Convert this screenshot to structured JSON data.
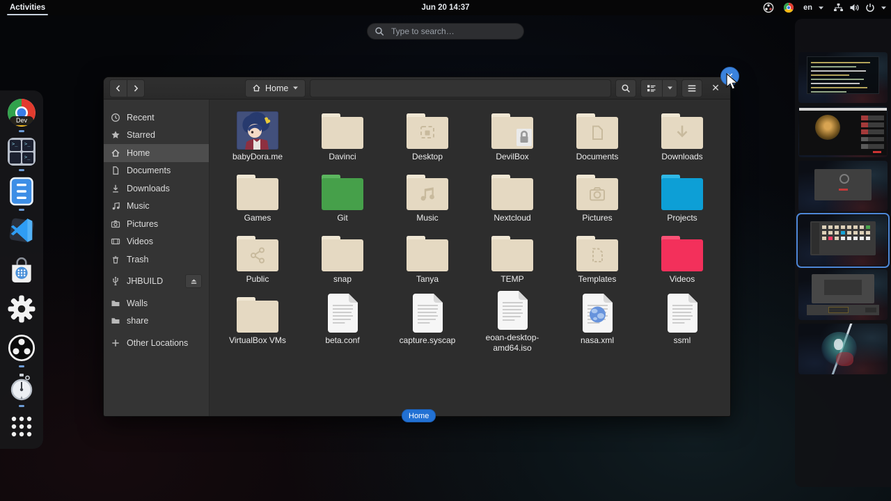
{
  "topbar": {
    "activities_label": "Activities",
    "clock": "Jun 20 14:37",
    "language": "en",
    "tray_icons": [
      "obs-icon",
      "chrome-icon",
      "language-menu",
      "network-icon",
      "volume-icon",
      "power-icon",
      "caret-down-icon"
    ]
  },
  "overview_search": {
    "placeholder": "Type to search…"
  },
  "dock": {
    "items": [
      {
        "id": "chrome-dev",
        "icon": "chrome-dev",
        "badge": "Dev",
        "running": true
      },
      {
        "id": "terminator",
        "icon": "terminator",
        "running": true
      },
      {
        "id": "files",
        "icon": "files",
        "running": true
      },
      {
        "id": "vscode",
        "icon": "vscode",
        "running": false
      },
      {
        "id": "software",
        "icon": "software",
        "running": false
      },
      {
        "id": "settings",
        "icon": "settings",
        "running": false
      },
      {
        "id": "obs",
        "icon": "obs",
        "running": true
      },
      {
        "id": "clocks",
        "icon": "stopwatch",
        "running": true
      },
      {
        "id": "app-grid",
        "icon": "app-grid",
        "running": false
      }
    ]
  },
  "window": {
    "toolbar": {
      "breadcrumb_label": "Home"
    },
    "sidebar": {
      "items": [
        {
          "icon": "clock",
          "label": "Recent"
        },
        {
          "icon": "star",
          "label": "Starred"
        },
        {
          "icon": "home",
          "label": "Home",
          "selected": true
        },
        {
          "icon": "document",
          "label": "Documents"
        },
        {
          "icon": "download",
          "label": "Downloads"
        },
        {
          "icon": "music",
          "label": "Music"
        },
        {
          "icon": "camera",
          "label": "Pictures"
        },
        {
          "icon": "film",
          "label": "Videos"
        },
        {
          "icon": "trash",
          "label": "Trash"
        },
        {
          "icon": "usb",
          "label": "JHBUILD",
          "eject": true,
          "gap": true
        },
        {
          "icon": "folder",
          "label": "Walls",
          "gap": true
        },
        {
          "icon": "folder",
          "label": "share"
        },
        {
          "icon": "plus",
          "label": "Other Locations",
          "gap": true
        }
      ]
    },
    "folder_colors": {
      "cream": "#e5d9c2",
      "green": "#46a04a",
      "cyan": "#0d9fd6",
      "pink": "#f3305b"
    },
    "files": [
      {
        "name": "babyDora.me",
        "icon": "image"
      },
      {
        "name": "Davinci",
        "icon": "folder",
        "color": "cream"
      },
      {
        "name": "Desktop",
        "icon": "folder",
        "color": "cream",
        "emblem": "desktop"
      },
      {
        "name": "DevilBox",
        "icon": "folder",
        "color": "cream",
        "emblem": "lock"
      },
      {
        "name": "Documents",
        "icon": "folder",
        "color": "cream",
        "emblem": "document"
      },
      {
        "name": "Downloads",
        "icon": "folder",
        "color": "cream",
        "emblem": "download"
      },
      {
        "name": "Games",
        "icon": "folder",
        "color": "cream"
      },
      {
        "name": "Git",
        "icon": "folder",
        "color": "green"
      },
      {
        "name": "Music",
        "icon": "folder",
        "color": "cream",
        "emblem": "music"
      },
      {
        "name": "Nextcloud",
        "icon": "folder",
        "color": "cream"
      },
      {
        "name": "Pictures",
        "icon": "folder",
        "color": "cream",
        "emblem": "camera"
      },
      {
        "name": "Projects",
        "icon": "folder",
        "color": "cyan"
      },
      {
        "name": "Public",
        "icon": "folder",
        "color": "cream",
        "emblem": "share"
      },
      {
        "name": "snap",
        "icon": "folder",
        "color": "cream"
      },
      {
        "name": "Tanya",
        "icon": "folder",
        "color": "cream"
      },
      {
        "name": "TEMP",
        "icon": "folder",
        "color": "cream"
      },
      {
        "name": "Templates",
        "icon": "folder",
        "color": "cream",
        "emblem": "template"
      },
      {
        "name": "Videos",
        "icon": "folder",
        "color": "pink"
      },
      {
        "name": "VirtualBox VMs",
        "icon": "folder",
        "color": "cream"
      },
      {
        "name": "beta.conf",
        "icon": "text"
      },
      {
        "name": "capture.syscap",
        "icon": "text"
      },
      {
        "name": "eoan-desktop-amd64.iso",
        "icon": "text"
      },
      {
        "name": "nasa.xml",
        "icon": "xml"
      },
      {
        "name": "ssml",
        "icon": "text"
      }
    ],
    "status_badge": "Home"
  },
  "workspaces": {
    "active_index": 3,
    "items": [
      {
        "name": "workspace-terminal",
        "kind": "terminal"
      },
      {
        "name": "workspace-video-browser",
        "kind": "video"
      },
      {
        "name": "workspace-dialog",
        "kind": "dialog"
      },
      {
        "name": "workspace-file-manager",
        "kind": "filesmini"
      },
      {
        "name": "workspace-obs-studio",
        "kind": "obswin"
      },
      {
        "name": "workspace-wallpaper",
        "kind": "miku"
      }
    ]
  }
}
